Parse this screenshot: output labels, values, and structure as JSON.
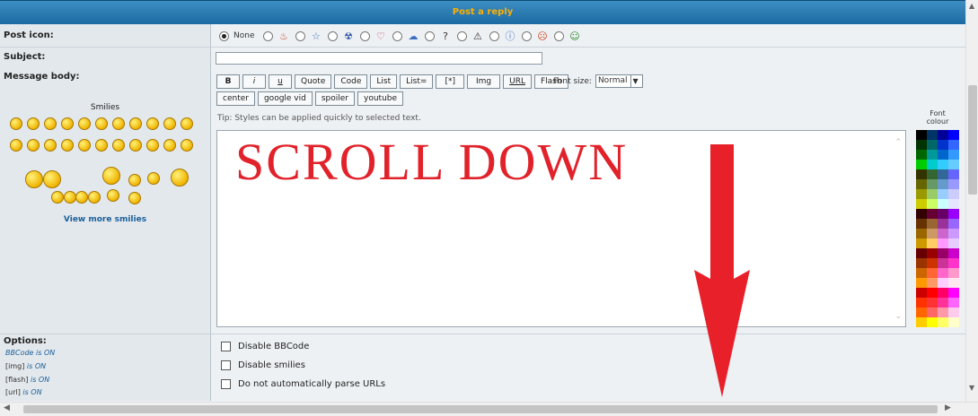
{
  "header": {
    "title": "Post a reply"
  },
  "labels": {
    "post_icon": "Post icon:",
    "subject": "Subject:",
    "message_body": "Message body:"
  },
  "post_icons": {
    "none_label": "None"
  },
  "subject": {
    "value": ""
  },
  "toolbar": {
    "row1": [
      "B",
      "i",
      "u",
      "Quote",
      "Code",
      "List",
      "List=",
      "[*]",
      "Img",
      "URL",
      "Flash"
    ],
    "row2": [
      "center",
      "google vid",
      "spoiler",
      "youtube"
    ],
    "font_size_label": "Font size:",
    "font_size_value": "Normal"
  },
  "tip": "Tip: Styles can be applied quickly to selected text.",
  "message": {
    "text": "SCROLL  DOWN"
  },
  "font_colour": {
    "line1": "Font",
    "line2": "colour"
  },
  "smilies": {
    "title": "Smilies",
    "view_more": "View more smilies"
  },
  "options": {
    "title": "Options:",
    "bbcode_label": "BBCode",
    "bbcode_state": "is ON",
    "img_label": "[img]",
    "img_state": "is ON",
    "flash_label": "[flash]",
    "flash_state": "is ON",
    "url_label": "[url]",
    "url_state": "is ON"
  },
  "checkboxes": [
    "Disable BBCode",
    "Disable smilies",
    "Do not automatically parse URLs"
  ],
  "colors": {
    "accent": "#1c6aa1",
    "header_text": "#ffb000",
    "message_text": "#e1222a",
    "arrow": "#e8202a"
  }
}
